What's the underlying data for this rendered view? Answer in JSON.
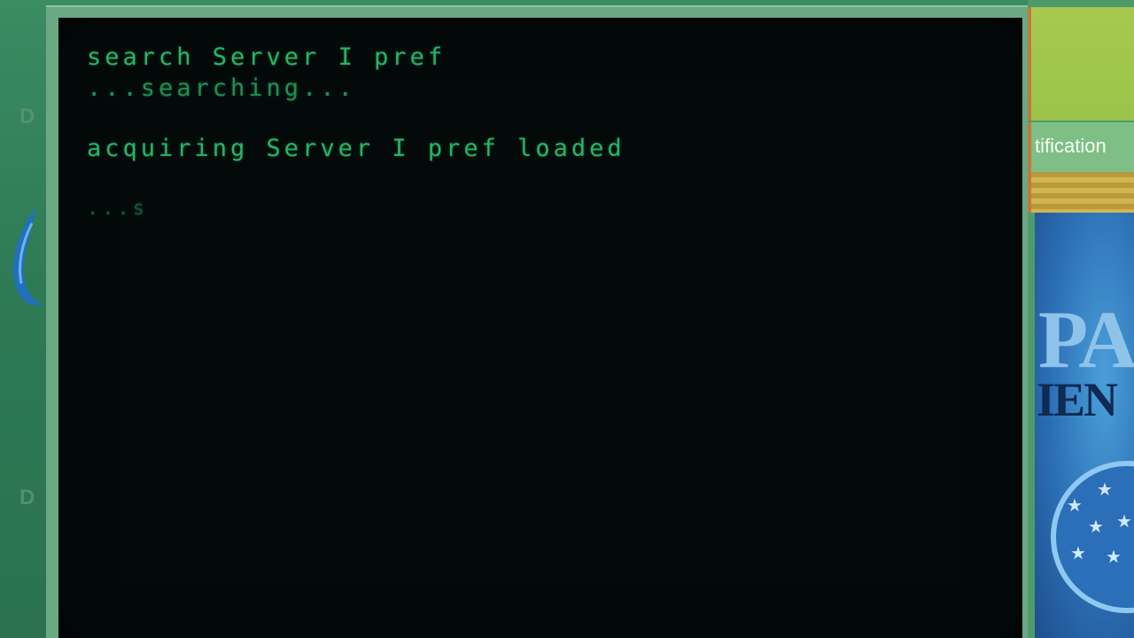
{
  "terminal": {
    "lines": [
      "search Server I pref",
      "...searching...",
      "acquiring Server I pref loaded",
      "...s"
    ]
  },
  "desktop": {
    "icon_labels": [
      "D",
      "D"
    ]
  },
  "background_window": {
    "tab_label": "tification",
    "poster_text_large": "PA",
    "poster_text_small": "IEN"
  },
  "colors": {
    "terminal_text": "#27b467",
    "terminal_bg": "#040a0a",
    "desktop_bg": "#2f7a55"
  }
}
